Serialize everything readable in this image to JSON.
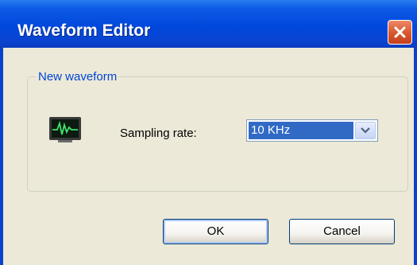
{
  "window": {
    "title": "Waveform Editor"
  },
  "group": {
    "legend": "New waveform"
  },
  "sampling": {
    "label": "Sampling rate:",
    "selected_value": "10 KHz"
  },
  "buttons": {
    "ok_label": "OK",
    "cancel_label": "Cancel"
  },
  "icons": {
    "close": "close-icon",
    "waveform": "waveform-monitor-icon",
    "dropdown": "chevron-down-icon"
  },
  "colors": {
    "titlebar": "#0048dc",
    "dialog_bg": "#ece9d8",
    "legend_text": "#0046d5",
    "selection": "#316ac5",
    "close_button": "#d8552c"
  }
}
